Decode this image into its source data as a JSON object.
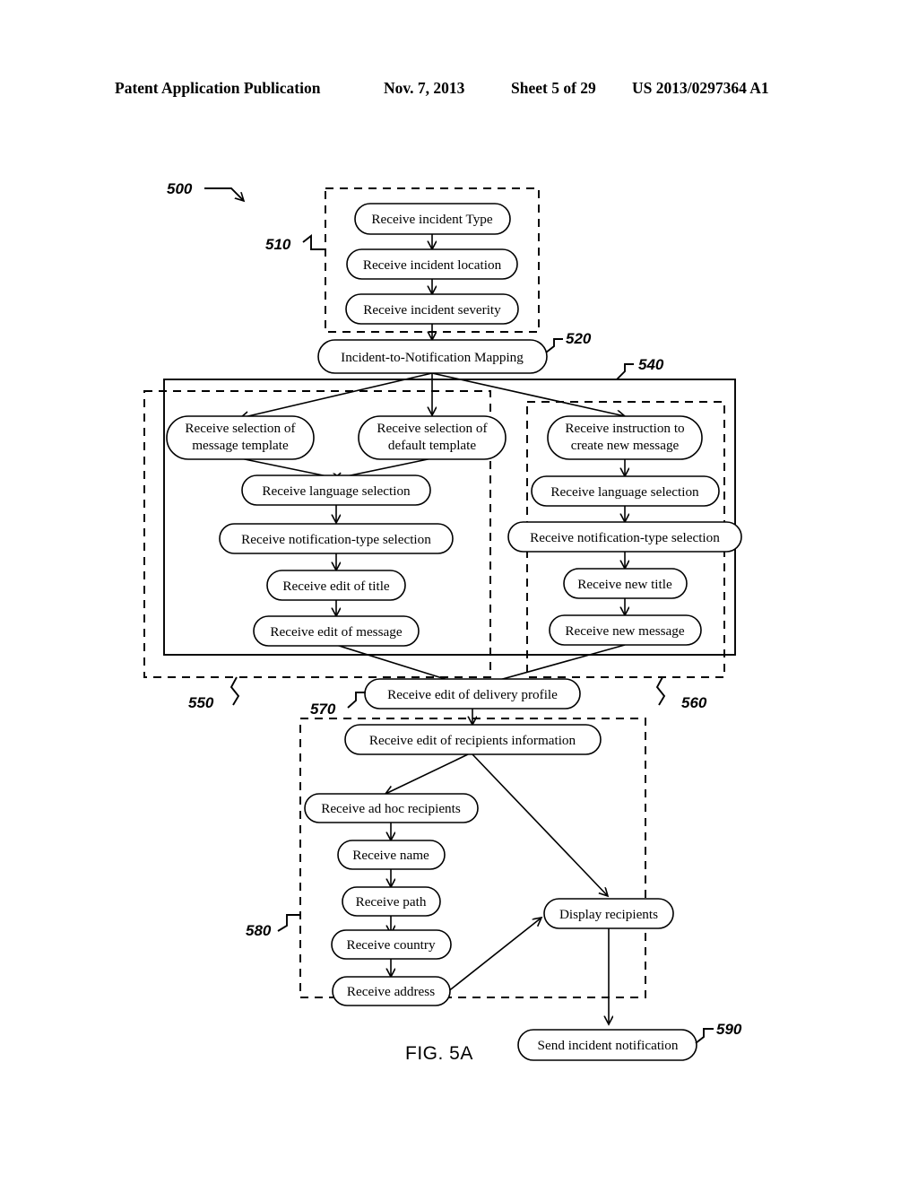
{
  "header": {
    "publication": "Patent Application Publication",
    "date": "Nov. 7, 2013",
    "sheet": "Sheet 5 of 29",
    "number": "US 2013/0297364 A1"
  },
  "figure": {
    "caption": "FIG. 5A",
    "reference_numerals": [
      {
        "id": "n500",
        "label": "500"
      },
      {
        "id": "n510",
        "label": "510"
      },
      {
        "id": "n520",
        "label": "520"
      },
      {
        "id": "n540",
        "label": "540"
      },
      {
        "id": "n550",
        "label": "550"
      },
      {
        "id": "n560",
        "label": "560"
      },
      {
        "id": "n570",
        "label": "570"
      },
      {
        "id": "n580",
        "label": "580"
      },
      {
        "id": "n590",
        "label": "590"
      }
    ],
    "nodes": [
      {
        "id": "incident_type",
        "label": "Receive incident Type"
      },
      {
        "id": "incident_loc",
        "label": "Receive incident location"
      },
      {
        "id": "incident_sev",
        "label": "Receive incident severity"
      },
      {
        "id": "mapping",
        "label": "Incident-to-Notification Mapping"
      },
      {
        "id": "sel_msg_tpl_1",
        "label": "Receive selection of"
      },
      {
        "id": "sel_msg_tpl_2",
        "label": "message template"
      },
      {
        "id": "sel_def_tpl_1",
        "label": "Receive selection of"
      },
      {
        "id": "sel_def_tpl_2",
        "label": "default template"
      },
      {
        "id": "new_msg_instr_1",
        "label": "Receive instruction to"
      },
      {
        "id": "new_msg_instr_2",
        "label": "create new message"
      },
      {
        "id": "lang_left",
        "label": "Receive language selection"
      },
      {
        "id": "lang_right",
        "label": "Receive language selection"
      },
      {
        "id": "notif_left",
        "label": "Receive notification-type selection"
      },
      {
        "id": "notif_right",
        "label": "Receive notification-type selection"
      },
      {
        "id": "edit_title",
        "label": "Receive edit of title"
      },
      {
        "id": "new_title",
        "label": "Receive new title"
      },
      {
        "id": "edit_message",
        "label": "Receive edit of message"
      },
      {
        "id": "new_message",
        "label": "Receive new message"
      },
      {
        "id": "delivery_profile",
        "label": "Receive edit of delivery profile"
      },
      {
        "id": "recipients_info",
        "label": "Receive edit of recipients information"
      },
      {
        "id": "ad_hoc",
        "label": "Receive ad hoc recipients"
      },
      {
        "id": "name",
        "label": "Receive name"
      },
      {
        "id": "path",
        "label": "Receive path"
      },
      {
        "id": "country",
        "label": "Receive country"
      },
      {
        "id": "address",
        "label": "Receive address"
      },
      {
        "id": "display_recip",
        "label": "Display recipients"
      },
      {
        "id": "send_notif",
        "label": "Send incident notification"
      }
    ]
  }
}
